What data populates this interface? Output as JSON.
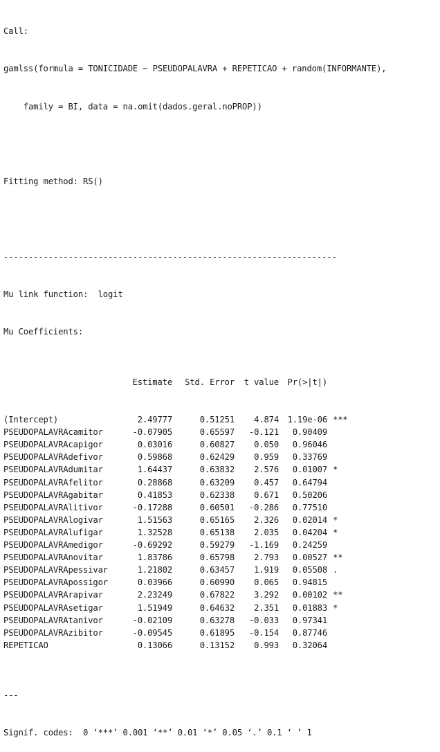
{
  "call_label": "Call:",
  "call_line1": "gamlss(formula = TONICIDADE ~ PSEUDOPALAVRA + REPETICAO + random(INFORMANTE),",
  "call_line2": "    family = BI, data = na.omit(dados.geral.noPROP))",
  "fitting_method": "Fitting method: RS()",
  "separator": "-------------------------------------------------------------------",
  "mu_link": "Mu link function:  logit",
  "mu_coef_label": "Mu Coefficients:",
  "table": {
    "headers": [
      "",
      "Estimate",
      "Std. Error",
      "t value",
      "Pr(>|t|)",
      ""
    ],
    "rows": [
      {
        "name": "(Intercept)",
        "estimate": "2.49777",
        "se": "0.51251",
        "t": "4.874",
        "p": "1.19e-06",
        "sig": "***"
      },
      {
        "name": "PSEUDOPALAVRAcamitor",
        "estimate": "-0.07905",
        "se": "0.65597",
        "t": "-0.121",
        "p": "0.90409",
        "sig": ""
      },
      {
        "name": "PSEUDOPALAVRAcapigor",
        "estimate": "0.03016",
        "se": "0.60827",
        "t": "0.050",
        "p": "0.96046",
        "sig": ""
      },
      {
        "name": "PSEUDOPALAVRAdefivor",
        "estimate": "0.59868",
        "se": "0.62429",
        "t": "0.959",
        "p": "0.33769",
        "sig": ""
      },
      {
        "name": "PSEUDOPALAVRAdumitar",
        "estimate": "1.64437",
        "se": "0.63832",
        "t": "2.576",
        "p": "0.01007",
        "sig": "*"
      },
      {
        "name": "PSEUDOPALAVRAfelitor",
        "estimate": "0.28868",
        "se": "0.63209",
        "t": "0.457",
        "p": "0.64794",
        "sig": ""
      },
      {
        "name": "PSEUDOPALAVRAgabitar",
        "estimate": "0.41853",
        "se": "0.62338",
        "t": "0.671",
        "p": "0.50206",
        "sig": ""
      },
      {
        "name": "PSEUDOPALAVRAlitivor",
        "estimate": "-0.17288",
        "se": "0.60501",
        "t": "-0.286",
        "p": "0.77510",
        "sig": ""
      },
      {
        "name": "PSEUDOPALAVRAlogivar",
        "estimate": "1.51563",
        "se": "0.65165",
        "t": "2.326",
        "p": "0.02014",
        "sig": "*"
      },
      {
        "name": "PSEUDOPALAVRAlufigar",
        "estimate": "1.32528",
        "se": "0.65138",
        "t": "2.035",
        "p": "0.04204",
        "sig": "*"
      },
      {
        "name": "PSEUDOPALAVRAmedigor",
        "estimate": "-0.69292",
        "se": "0.59279",
        "t": "-1.169",
        "p": "0.24259",
        "sig": ""
      },
      {
        "name": "PSEUDOPALAVRAnovitar",
        "estimate": "1.83786",
        "se": "0.65798",
        "t": "2.793",
        "p": "0.00527",
        "sig": "**"
      },
      {
        "name": "PSEUDOPALAVRApessivar",
        "estimate": "1.21802",
        "se": "0.63457",
        "t": "1.919",
        "p": "0.05508",
        "sig": "."
      },
      {
        "name": "PSEUDOPALAVRApossigor",
        "estimate": "0.03966",
        "se": "0.60990",
        "t": "0.065",
        "p": "0.94815",
        "sig": ""
      },
      {
        "name": "PSEUDOPALAVRArapivar",
        "estimate": "2.23249",
        "se": "0.67822",
        "t": "3.292",
        "p": "0.00102",
        "sig": "**"
      },
      {
        "name": "PSEUDOPALAVRAsetigar",
        "estimate": "1.51949",
        "se": "0.64632",
        "t": "2.351",
        "p": "0.01883",
        "sig": "*"
      },
      {
        "name": "PSEUDOPALAVRAtanivor",
        "estimate": "-0.02109",
        "se": "0.63278",
        "t": "-0.033",
        "p": "0.97341",
        "sig": ""
      },
      {
        "name": "PSEUDOPALAVRAzibitor",
        "estimate": "-0.09545",
        "se": "0.61895",
        "t": "-0.154",
        "p": "0.87746",
        "sig": ""
      },
      {
        "name": "REPETICAO",
        "estimate": "0.13066",
        "se": "0.13152",
        "t": "0.993",
        "p": "0.32064",
        "sig": ""
      }
    ]
  },
  "footer_sep": "---",
  "signif_codes": "Signif. codes:  0 ‘***’ 0.001 ‘**’ 0.01 ‘*’ 0.05 ‘.’ 0.1 ‘ ’ 1"
}
